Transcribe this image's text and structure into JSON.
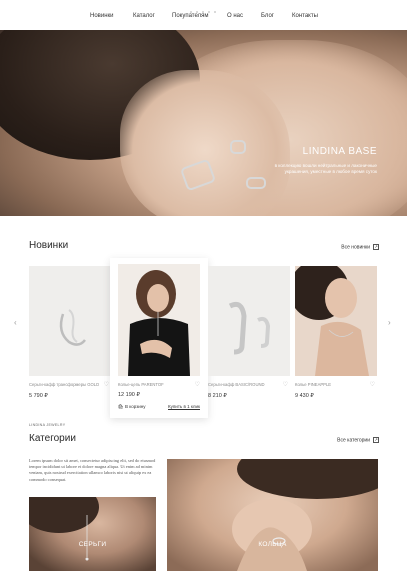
{
  "nav": {
    "items": [
      "Новинки",
      "Каталог",
      "Покупателям",
      "О нас",
      "Блог",
      "Контакты"
    ]
  },
  "hero": {
    "title": "LINDINA BASE",
    "subtitle": "в коллекцию вошли нейтральные и лаконичные украшения, уместные в любое время суток",
    "arrow_icon": "arrow-up-right-icon"
  },
  "new_section": {
    "title": "Новинки",
    "all_label": "Все новинки",
    "products": [
      {
        "name": "Серьги-кафф трансформеры GOLD",
        "price": "5 790 ₽"
      },
      {
        "name": "Колье-цепь PARENTOF",
        "price": "12 190 ₽",
        "cart_label": "В корзину",
        "oneclick_label": "Купить в 1 клик"
      },
      {
        "name": "Серьги-кафф BASIC/ROUND",
        "price": "8 210 ₽"
      },
      {
        "name": "Колье PINEAPPLE",
        "price": "9 430 ₽"
      }
    ]
  },
  "brand_small": "LINDINA JEWELRY",
  "categories_section": {
    "title": "Категории",
    "all_label": "Все категории",
    "description": "Lorem ipsum dolor sit amet, consectetur adipiscing elit, sed do eiusmod tempor incididunt ut labore et dolore magna aliqua. Ut enim ad minim veniam, quis nostrud exercitation ullamco laboris nisi ut aliquip ex ea commodo consequat.",
    "tiles": [
      {
        "label": "СЕРЬГИ"
      },
      {
        "label": "КОЛЬЦА"
      }
    ]
  },
  "colors": {
    "background": "#ffffff",
    "text": "#2b2b2b",
    "muted": "#8a8a8a",
    "card_bg": "#efeeec"
  }
}
